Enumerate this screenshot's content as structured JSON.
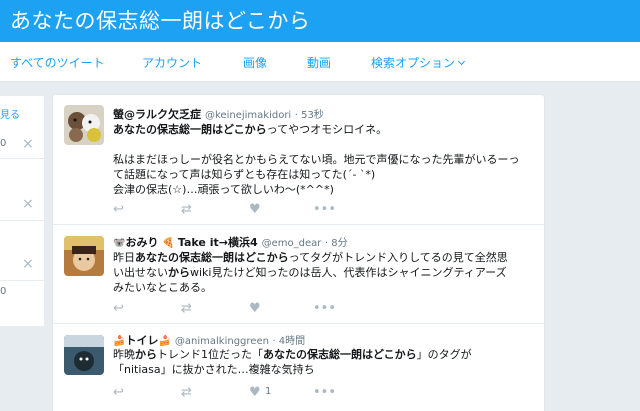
{
  "page": {
    "title": "あなたの保志総一朗はどこから"
  },
  "subnav": {
    "tabs": [
      "すべてのツイート",
      "アカウント",
      "画像",
      "動画"
    ],
    "options_label": "検索オプション"
  },
  "sidebar": {
    "link": "見る",
    "items": [
      {
        "count": "0"
      },
      {
        "count": ""
      },
      {
        "count": ""
      },
      {
        "count": "0"
      }
    ]
  },
  "tweets": [
    {
      "name": "螢@ラルク欠乏症",
      "handle": "@keinejimakidori",
      "time": "· 53秒",
      "lines": [
        {
          "bold": "あなたの保志総一朗はどこから",
          "text": "ってやつオモシロイネ。"
        },
        {
          "bold": "",
          "text": ""
        },
        {
          "bold": "",
          "text": "私はまだほっしーが役名とかもらえてない頃。地元で声優になった先輩がいるーっ"
        },
        {
          "bold": "",
          "text": "て話題になって声は知らずとも存在は知ってた(´- `*)"
        },
        {
          "bold": "",
          "text": "会津の保志(☆)…頑張って欲しいわ〜(*^^*)"
        }
      ],
      "like_count": ""
    },
    {
      "name": "おみり",
      "name2": "Take it→横浜4",
      "handle": "@emo_dear",
      "time": "· 8分",
      "lines": [
        {
          "pre": "昨日",
          "bold": "あなたの保志総一朗はどこから",
          "text": "ってタグがトレンド入りしてるの見て全然思"
        },
        {
          "pre": "い出せない",
          "bold": "から",
          "text": "wiki見たけど知ったのは岳人、代表作はシャイニングティアーズ"
        },
        {
          "pre": "みたいなとこある。",
          "bold": "",
          "text": ""
        }
      ],
      "like_count": ""
    },
    {
      "name": "トイレ",
      "handle": "@animalkinggreen",
      "time": "· 4時間",
      "lines": [
        {
          "pre": "昨晩",
          "bold": "から",
          "text": "トレンド1位だった「",
          "bold2": "あなたの保志総一朗はどこから",
          "post": "」のタグが"
        },
        {
          "pre": "「nitiasa」に抜かされた…複雑な気持ち",
          "bold": "",
          "text": ""
        }
      ],
      "like_count": "1"
    }
  ],
  "icons": [
    "reply-icon",
    "retweet-icon",
    "like-icon",
    "more-icon",
    "close-icon"
  ],
  "colors": {
    "brand": "#1da1f2",
    "text": "#14171a",
    "muted": "#657786",
    "icon": "#aab8c2"
  }
}
